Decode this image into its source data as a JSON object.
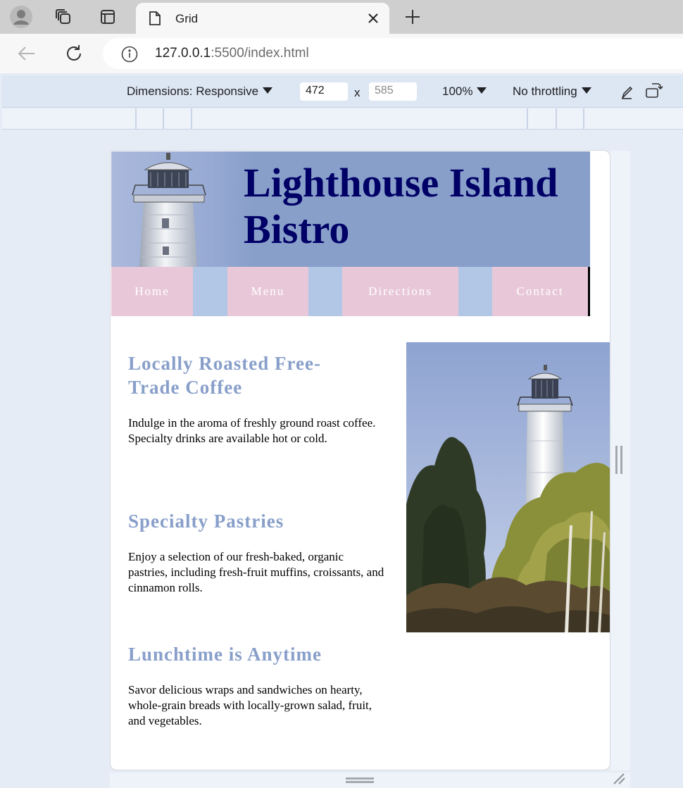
{
  "browser": {
    "tab": {
      "title": "Grid"
    },
    "address": {
      "host": "127.0.0.1",
      "rest": ":5500/index.html"
    }
  },
  "devtools": {
    "dimensions_label": "Dimensions: Responsive",
    "width": "472",
    "height": "585",
    "times": "x",
    "zoom": "100%",
    "throttling": "No throttling"
  },
  "site": {
    "title": "Lighthouse Island Bistro",
    "nav": [
      "Home",
      "Menu",
      "Directions",
      "Contact"
    ],
    "sections": [
      {
        "heading": "Locally Roasted Free-Trade Coffee",
        "body": "Indulge in the aroma of freshly ground roast coffee. Specialty drinks are available hot or cold."
      },
      {
        "heading": "Specialty Pastries",
        "body": "Enjoy a selection of our fresh-baked, organic pastries, including fresh-fruit muffins, croissants, and cinnamon rolls."
      },
      {
        "heading": "Lunchtime is Anytime",
        "body": "Savor delicious wraps and sandwiches on hearty, whole-grain breads with locally-grown salad, fruit, and vegetables."
      }
    ]
  },
  "colors": {
    "header_bg": "#889fca",
    "title_text": "#000066",
    "nav_item_bg": "#e8c8d8",
    "nav_gap_bg": "#b2c6e6",
    "heading_text": "#889fca"
  },
  "icons": [
    "profile-icon",
    "workspaces-icon",
    "vertical-tabs-icon",
    "page-icon",
    "close-icon",
    "new-tab-icon",
    "back-icon",
    "refresh-icon",
    "info-icon",
    "caret-down-icon",
    "pen-icon",
    "rotate-icon",
    "drag-handle-icon",
    "resize-corner-icon"
  ]
}
